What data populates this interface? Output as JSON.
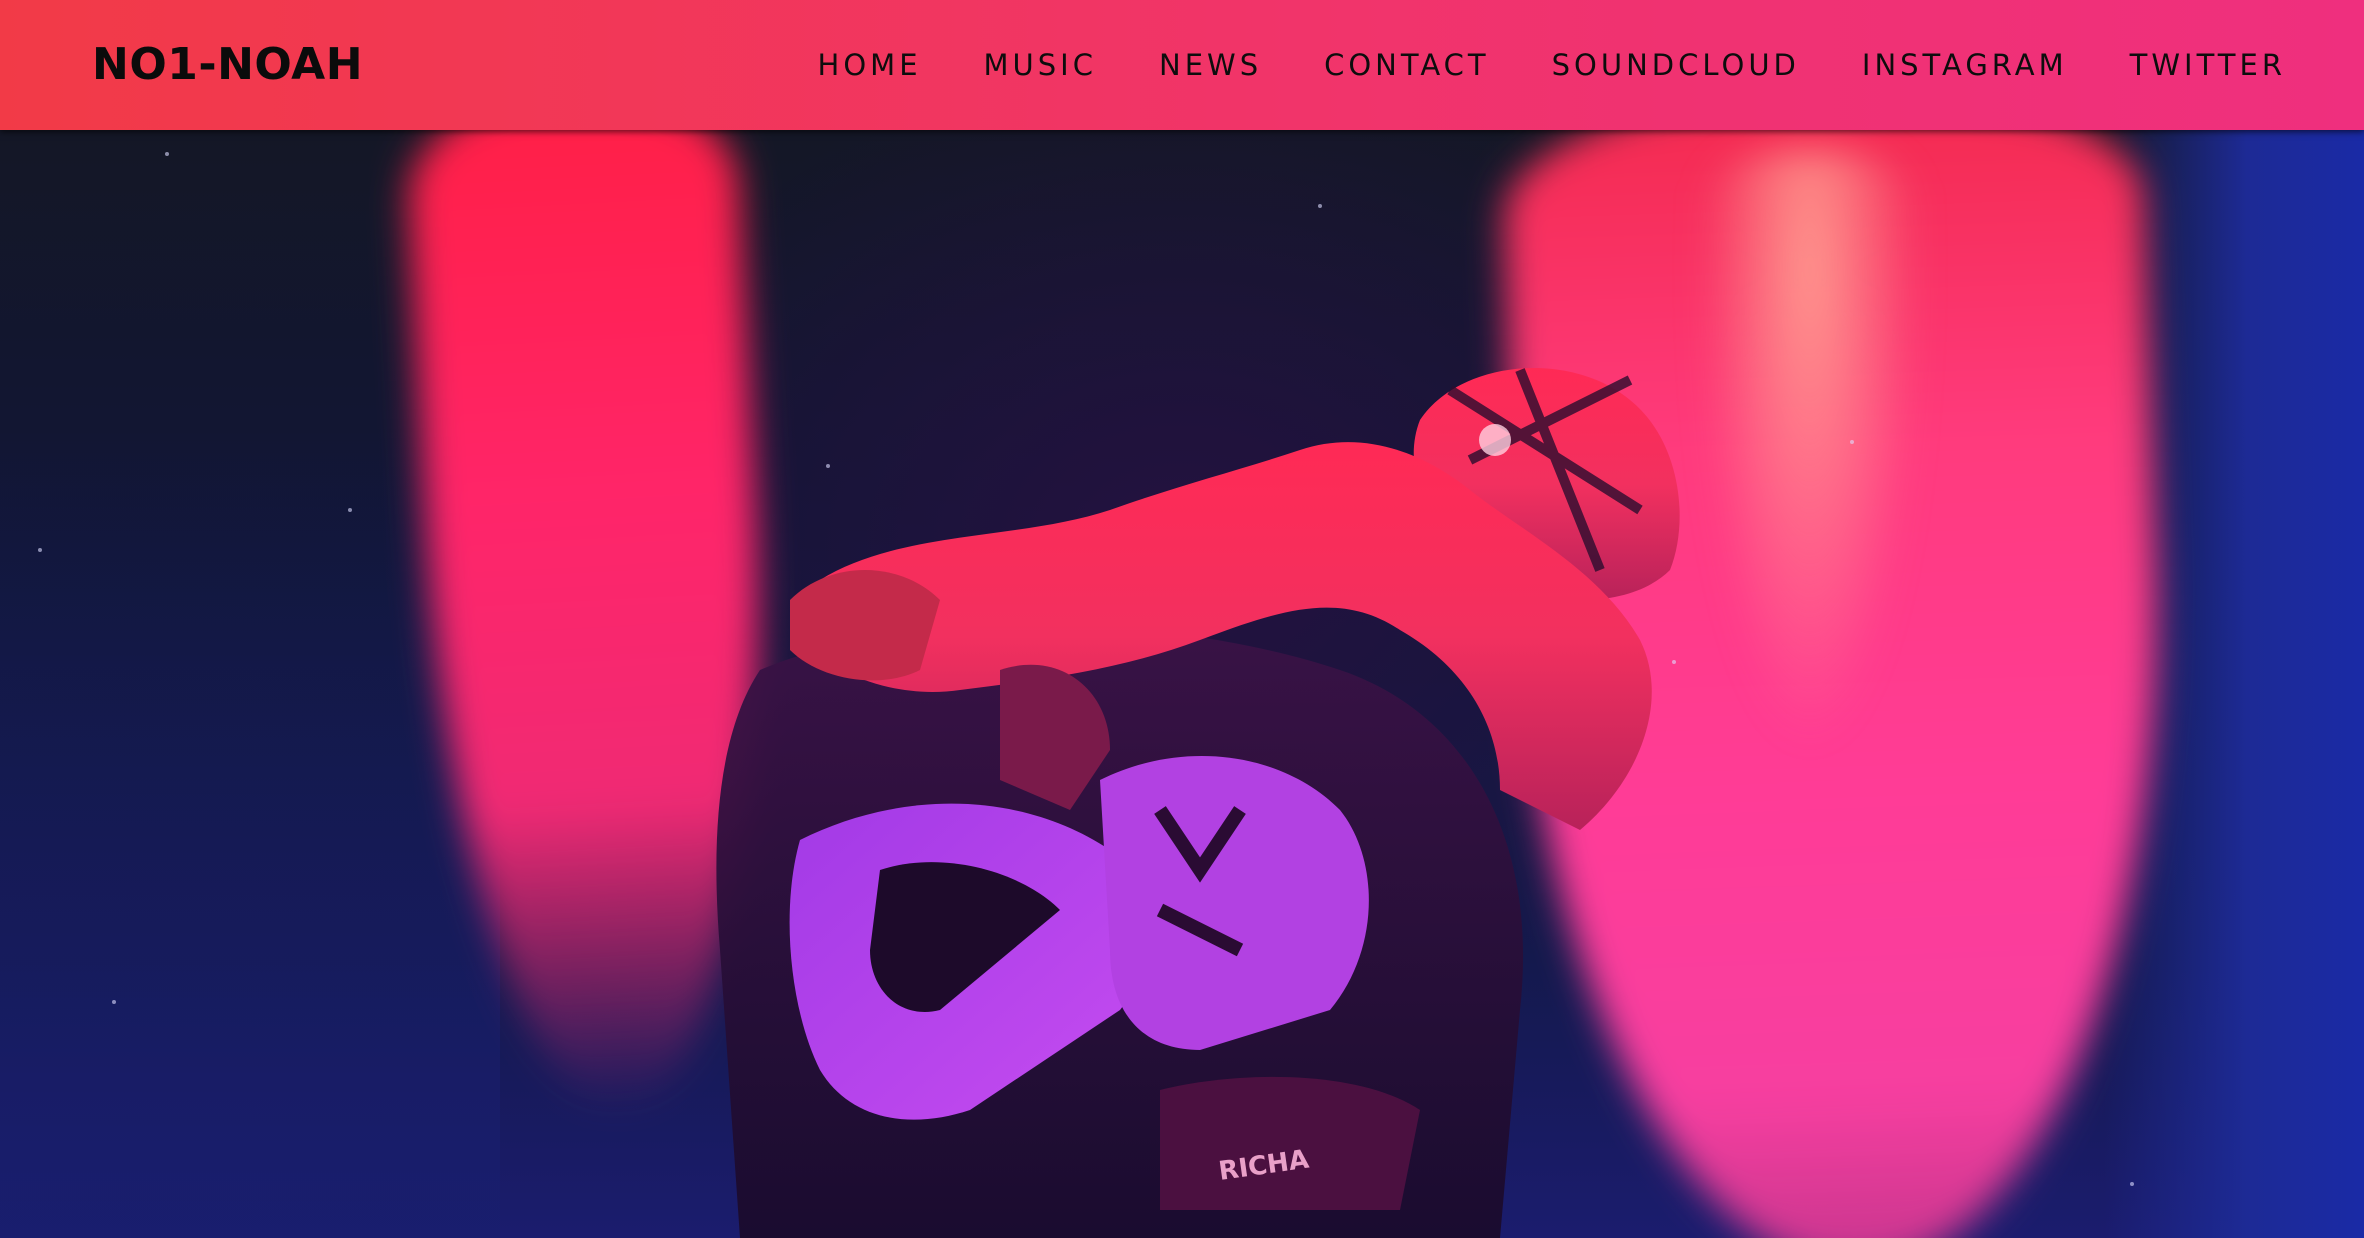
{
  "header": {
    "brand": "NO1-NOAH",
    "nav": [
      {
        "label": "HOME"
      },
      {
        "label": "MUSIC"
      },
      {
        "label": "NEWS"
      },
      {
        "label": "CONTACT"
      },
      {
        "label": "SOUNDCLOUD"
      },
      {
        "label": "INSTAGRAM"
      },
      {
        "label": "TWITTER"
      }
    ]
  },
  "hero": {
    "tank_text": "RICHA"
  },
  "colors": {
    "header_start": "#f23a47",
    "header_end": "#ef2f7e",
    "hero_background": "#141726",
    "beam_red": "#ff2569",
    "beam_pink": "#ff3c97",
    "bike_violet": "#a63be8"
  }
}
